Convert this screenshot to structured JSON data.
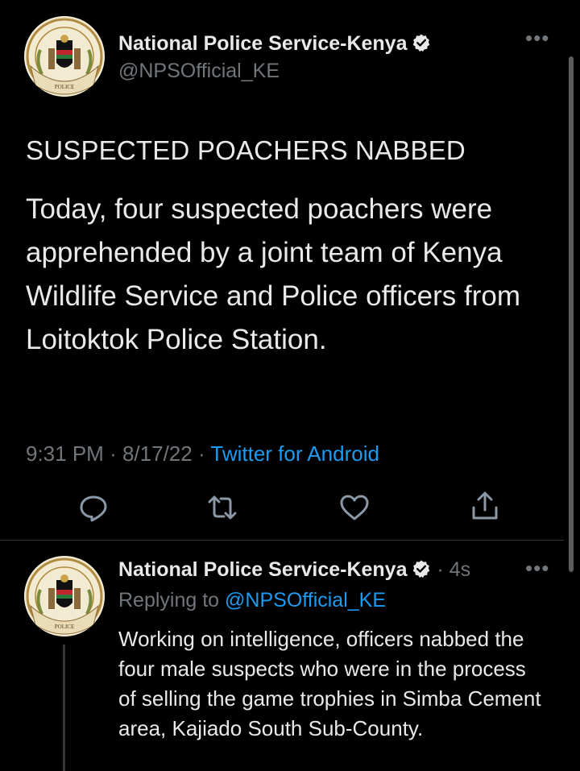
{
  "tweet": {
    "author_name": "National Police Service-Kenya",
    "author_handle": "@NPSOfficial_KE",
    "avatar_icon": "kenya-police-emblem",
    "verified_icon": "verified-badge-icon",
    "more_icon": "more-options-icon",
    "headline": "SUSPECTED POACHERS NABBED",
    "body": "Today, four suspected poachers were apprehended by a joint team of Kenya Wildlife Service and Police officers from Loitoktok Police Station.",
    "time": "9:31 PM",
    "date": "8/17/22",
    "source": "Twitter for Android",
    "actions": [
      "reply-icon",
      "retweet-icon",
      "like-icon",
      "share-icon"
    ]
  },
  "reply": {
    "author_name": "National Police Service-Kenya",
    "age": "4s",
    "replying_label": "Replying to",
    "replying_to": "@NPSOfficial_KE",
    "body": "Working on intelligence, officers nabbed the four male suspects who were in the process of selling the game trophies in Simba Cement area, Kajiado South Sub-County."
  },
  "colors": {
    "background": "#000000",
    "text": "#e7e9ea",
    "muted": "#71767b",
    "link": "#1d9bf0"
  }
}
